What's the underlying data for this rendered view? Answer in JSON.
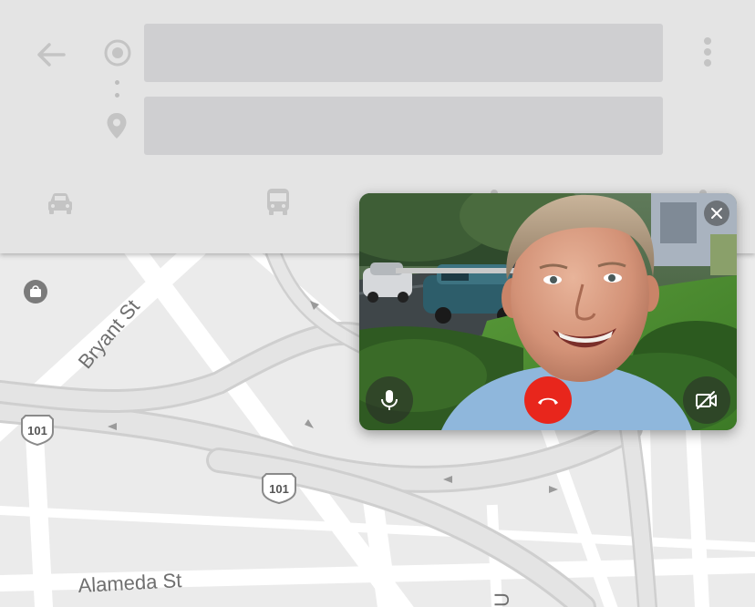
{
  "directions": {
    "origin_value": "",
    "destination_value": "",
    "modes": [
      "car-icon",
      "bus-icon",
      "walk-icon",
      "bike-icon"
    ],
    "icons": {
      "back": "arrow-left-icon",
      "origin": "origin-circle-icon",
      "destination": "map-pin-icon",
      "more": "more-vert-icon"
    }
  },
  "map": {
    "labels": {
      "bryant": "Bryant St",
      "alameda": "Alameda St",
      "partial_bottom": "U",
      "shield_1": "101",
      "shield_2": "101"
    },
    "icons": [
      "shopping-bag-icon"
    ]
  },
  "video_call": {
    "controls": [
      "mic-icon",
      "hangup-icon",
      "camera-off-icon",
      "close-icon"
    ],
    "colors": {
      "hangup": "#e8261c"
    }
  }
}
